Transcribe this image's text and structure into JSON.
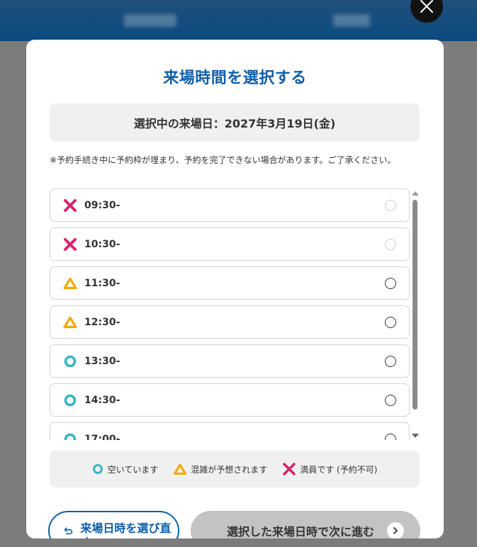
{
  "modal": {
    "title": "来場時間を選択する",
    "selected_date": "選択中の来場日：2027年3月19日(金)",
    "notice": "※予約手続き中に予約枠が埋まり、予約を完了できない場合があります。ご了承ください。"
  },
  "slots": [
    {
      "time": "09:30-",
      "status": "full",
      "icon": "cross-icon",
      "selectable": false
    },
    {
      "time": "10:30-",
      "status": "full",
      "icon": "cross-icon",
      "selectable": false
    },
    {
      "time": "11:30-",
      "status": "crowded",
      "icon": "triangle-icon",
      "selectable": true
    },
    {
      "time": "12:30-",
      "status": "crowded",
      "icon": "triangle-icon",
      "selectable": true
    },
    {
      "time": "13:30-",
      "status": "available",
      "icon": "circle-icon",
      "selectable": true
    },
    {
      "time": "14:30-",
      "status": "available",
      "icon": "circle-icon",
      "selectable": true
    },
    {
      "time": "17:00-",
      "status": "available",
      "icon": "circle-icon",
      "selectable": true
    }
  ],
  "legend": {
    "available": "空いています",
    "crowded": "混雑が予想されます",
    "full": "満員です (予約不可)"
  },
  "buttons": {
    "back": "来場日時を選び直す",
    "next": "選択した来場日時で次に進む"
  },
  "colors": {
    "accent": "#0f5fa8",
    "full": "#d6246e",
    "crowded": "#f2a900",
    "available": "#3bb3c3",
    "header": "#0c4a80"
  }
}
